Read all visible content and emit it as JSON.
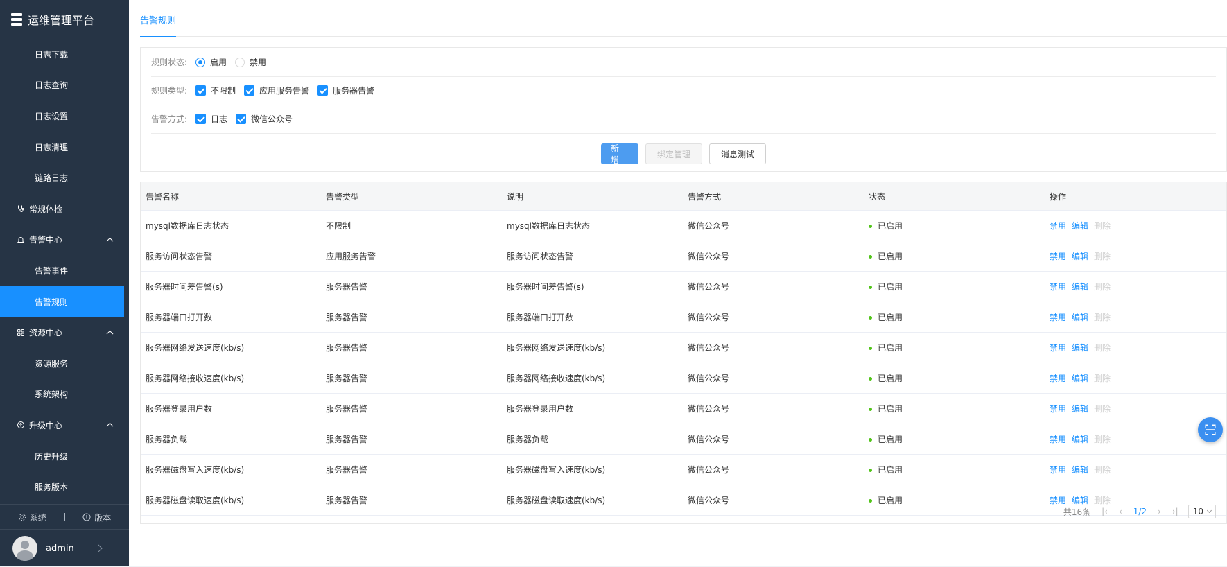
{
  "app": {
    "title": "运维管理平台"
  },
  "sidebar": {
    "items": [
      {
        "label": "日志下载",
        "type": "sub"
      },
      {
        "label": "日志查询",
        "type": "sub"
      },
      {
        "label": "日志设置",
        "type": "sub"
      },
      {
        "label": "日志清理",
        "type": "sub"
      },
      {
        "label": "链路日志",
        "type": "sub"
      },
      {
        "label": "常规体检",
        "type": "top",
        "icon": "stethoscope-icon"
      },
      {
        "label": "告警中心",
        "type": "top",
        "icon": "bell-icon",
        "expanded": true
      },
      {
        "label": "告警事件",
        "type": "sub"
      },
      {
        "label": "告警规则",
        "type": "sub",
        "active": true
      },
      {
        "label": "资源中心",
        "type": "top",
        "icon": "grid-icon",
        "expanded": true
      },
      {
        "label": "资源服务",
        "type": "sub"
      },
      {
        "label": "系统架构",
        "type": "sub"
      },
      {
        "label": "升级中心",
        "type": "top",
        "icon": "upgrade-icon",
        "expanded": true
      },
      {
        "label": "历史升级",
        "type": "sub"
      },
      {
        "label": "服务版本",
        "type": "sub"
      }
    ],
    "footer": {
      "system": "系统",
      "version": "版本"
    },
    "user": {
      "name": "admin"
    }
  },
  "tabs": [
    {
      "label": "告警规则"
    }
  ],
  "filter": {
    "status": {
      "label": "规则状态:",
      "options": [
        "启用",
        "禁用"
      ],
      "selected": "启用"
    },
    "type": {
      "label": "规则类型:",
      "options": [
        "不限制",
        "应用服务告警",
        "服务器告警"
      ]
    },
    "method": {
      "label": "告警方式:",
      "options": [
        "日志",
        "微信公众号"
      ]
    },
    "buttons": {
      "add": "新 增",
      "bind": "绑定管理",
      "test": "消息测试"
    }
  },
  "table": {
    "headers": [
      "告警名称",
      "告警类型",
      "说明",
      "告警方式",
      "状态",
      "操作"
    ],
    "actions": [
      "禁用",
      "编辑",
      "删除"
    ],
    "rows": [
      {
        "name": "mysql数据库日志状态",
        "type": "不限制",
        "desc": "mysql数据库日志状态",
        "method": "微信公众号",
        "status": "已启用"
      },
      {
        "name": "服务访问状态告警",
        "type": "应用服务告警",
        "desc": "服务访问状态告警",
        "method": "微信公众号",
        "status": "已启用"
      },
      {
        "name": "服务器时间差告警(s)",
        "type": "服务器告警",
        "desc": "服务器时间差告警(s)",
        "method": "微信公众号",
        "status": "已启用"
      },
      {
        "name": "服务器端口打开数",
        "type": "服务器告警",
        "desc": "服务器端口打开数",
        "method": "微信公众号",
        "status": "已启用"
      },
      {
        "name": "服务器网络发送速度(kb/s)",
        "type": "服务器告警",
        "desc": "服务器网络发送速度(kb/s)",
        "method": "微信公众号",
        "status": "已启用"
      },
      {
        "name": "服务器网络接收速度(kb/s)",
        "type": "服务器告警",
        "desc": "服务器网络接收速度(kb/s)",
        "method": "微信公众号",
        "status": "已启用"
      },
      {
        "name": "服务器登录用户数",
        "type": "服务器告警",
        "desc": "服务器登录用户数",
        "method": "微信公众号",
        "status": "已启用"
      },
      {
        "name": "服务器负载",
        "type": "服务器告警",
        "desc": "服务器负载",
        "method": "微信公众号",
        "status": "已启用"
      },
      {
        "name": "服务器磁盘写入速度(kb/s)",
        "type": "服务器告警",
        "desc": "服务器磁盘写入速度(kb/s)",
        "method": "微信公众号",
        "status": "已启用"
      },
      {
        "name": "服务器磁盘读取速度(kb/s)",
        "type": "服务器告警",
        "desc": "服务器磁盘读取速度(kb/s)",
        "method": "微信公众号",
        "status": "已启用"
      }
    ]
  },
  "pagination": {
    "total": "共16条",
    "page": "1/2",
    "page_size": "10"
  },
  "colors": {
    "sidebar": "#263445",
    "accent": "#1890ff",
    "success": "#52c41a"
  }
}
